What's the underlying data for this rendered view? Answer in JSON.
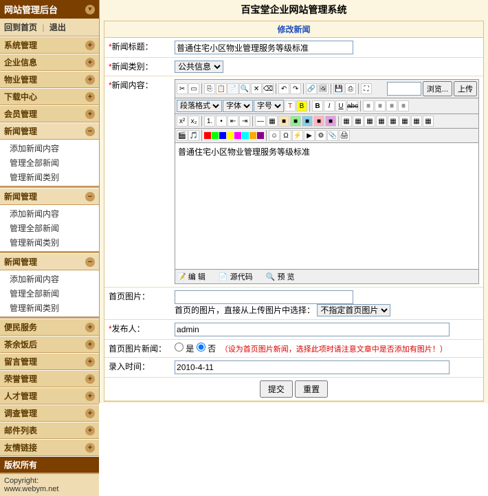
{
  "sidebar": {
    "title": "网站管理后台",
    "nav_back": "回到首页",
    "nav_exit": "退出",
    "groups": [
      {
        "label": "系统管理",
        "ico": "+"
      },
      {
        "label": "企业信息",
        "ico": "+"
      },
      {
        "label": "物业管理",
        "ico": "+"
      },
      {
        "label": "下载中心",
        "ico": "+"
      },
      {
        "label": "会员管理",
        "ico": "+"
      },
      {
        "label": "新闻管理",
        "ico": "−",
        "open": true,
        "subs": [
          "添加新闻内容",
          "管理全部新闻",
          "管理新闻类别"
        ]
      },
      {
        "label": "新闻管理",
        "ico": "−",
        "open": true,
        "subs": [
          "添加新闻内容",
          "管理全部新闻",
          "管理新闻类别"
        ]
      },
      {
        "label": "新闻管理",
        "ico": "−",
        "open": true,
        "subs": [
          "添加新闻内容",
          "管理全部新闻",
          "管理新闻类别"
        ]
      },
      {
        "label": "便民服务",
        "ico": "+"
      },
      {
        "label": "茶余饭后",
        "ico": "+"
      },
      {
        "label": "留言管理",
        "ico": "+"
      },
      {
        "label": "荣誉管理",
        "ico": "+"
      },
      {
        "label": "人才管理",
        "ico": "+"
      },
      {
        "label": "调查管理",
        "ico": "+"
      },
      {
        "label": "邮件列表",
        "ico": "+"
      },
      {
        "label": "友情链接",
        "ico": "+"
      },
      {
        "label": "版权所有",
        "ico": "",
        "dark": true
      }
    ],
    "copyright_l1": "Copyright:",
    "copyright_l2": "www.webym.net"
  },
  "main": {
    "app_title": "百宝堂企业网站管理系统",
    "panel_title": "修改新闻",
    "labels": {
      "title": "新闻标题：",
      "category": "新闻类别：",
      "content": "新闻内容：",
      "homepic": "首页图片：",
      "author": "发布人：",
      "ishome": "首页图片新闻：",
      "time": "录入时间：",
      "submit": "提交",
      "reset": "重置",
      "browse": "浏览...",
      "upload": "上传"
    },
    "values": {
      "title": "普通住宅小区物业管理服务等级标准",
      "category": "公共信息",
      "content": "普通住宅小区物业管理服务等级标准",
      "pic_hint": "首页的图片，直接从上传图片中选择：",
      "pic_select": "不指定首页图片",
      "author": "admin",
      "radio_yes": "是",
      "radio_no": "否",
      "radio_hint": "（设为首页图片新闻，选择此项时请注意文章中是否添加有图片！）",
      "time": "2010-4-11"
    },
    "editor": {
      "para": "段落格式",
      "font": "字体",
      "size": "字号",
      "foot_edit": "编  辑",
      "foot_src": "源代码",
      "foot_preview": "预  览"
    }
  }
}
